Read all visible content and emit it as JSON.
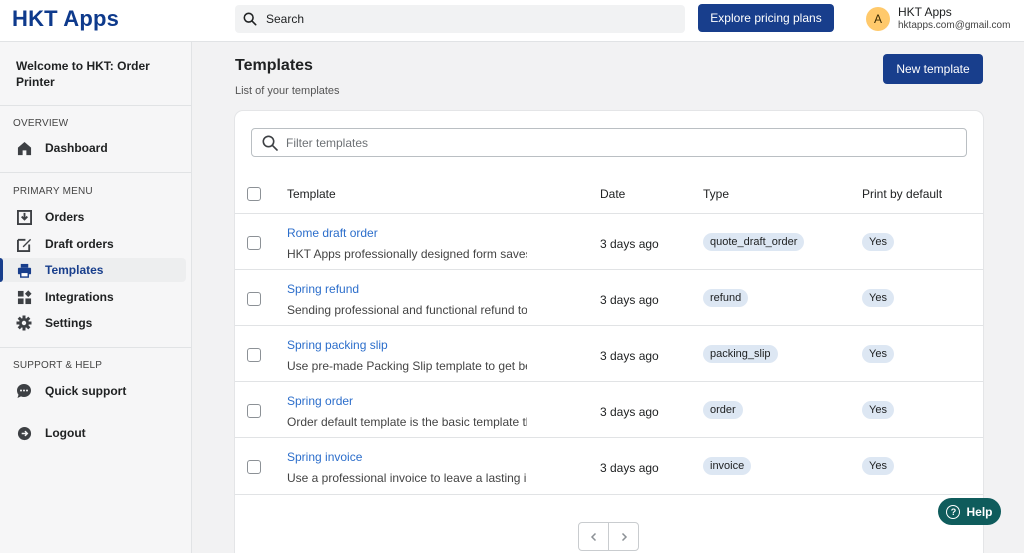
{
  "header": {
    "brand": "HKT Apps",
    "search_placeholder": "Search",
    "pricing_label": "Explore pricing plans",
    "user": {
      "initial": "A",
      "name": "HKT Apps",
      "email": "hktapps.com@gmail.com"
    }
  },
  "sidebar": {
    "welcome_line1": "Welcome to HKT: Order",
    "welcome_line2": "Printer",
    "sections": [
      "OVERVIEW",
      "PRIMARY MENU",
      "SUPPORT & HELP"
    ],
    "items": [
      {
        "label": "Dashboard",
        "icon": "home-icon",
        "active": false
      },
      {
        "label": "Orders",
        "icon": "inbox-download-icon",
        "active": false
      },
      {
        "label": "Draft orders",
        "icon": "edit-icon",
        "active": false
      },
      {
        "label": "Templates",
        "icon": "printer-icon",
        "active": true
      },
      {
        "label": "Integrations",
        "icon": "apps-icon",
        "active": false
      },
      {
        "label": "Settings",
        "icon": "gear-icon",
        "active": false
      },
      {
        "label": "Quick support",
        "icon": "chat-icon",
        "active": false
      },
      {
        "label": "Logout",
        "icon": "logout-icon",
        "active": false
      }
    ]
  },
  "main": {
    "title": "Templates",
    "subtitle": "List of your templates",
    "new_button": "New template",
    "filter_placeholder": "Filter templates",
    "columns": [
      "Template",
      "Date",
      "Type",
      "Print by default"
    ],
    "rows": [
      {
        "name": "Rome draft order",
        "desc": "HKT Apps professionally designed form saves",
        "date": "3 days ago",
        "type": "quote_draft_order",
        "default": "Yes"
      },
      {
        "name": "Spring refund",
        "desc": "Sending professional and functional refund to y",
        "date": "3 days ago",
        "type": "refund",
        "default": "Yes"
      },
      {
        "name": "Spring packing slip",
        "desc": "Use pre-made Packing Slip template to get bet",
        "date": "3 days ago",
        "type": "packing_slip",
        "default": "Yes"
      },
      {
        "name": "Spring order",
        "desc": "Order default template is the basic template th",
        "date": "3 days ago",
        "type": "order",
        "default": "Yes"
      },
      {
        "name": "Spring invoice",
        "desc": "Use a professional invoice to leave a lasting im",
        "date": "3 days ago",
        "type": "invoice",
        "default": "Yes"
      }
    ],
    "help_label": "Help"
  },
  "colors": {
    "brand": "#0e3a8c",
    "primary_button": "#183e8c",
    "link": "#2c6ecb",
    "help": "#0f5c5c"
  }
}
